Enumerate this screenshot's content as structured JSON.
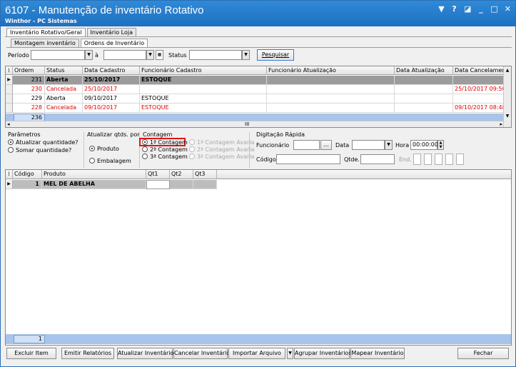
{
  "window": {
    "title": "6107 - Manutenção de inventário Rotativo",
    "subtitle": "Winthor - PC Sistemas",
    "controls": [
      "▼",
      "?",
      "◪",
      "_",
      "□",
      "✕"
    ]
  },
  "tabs_top": [
    "Inventário Rotativo/Geral",
    "Inventário Loja"
  ],
  "tabs_sub": [
    "Montagem inventário",
    "Ordens de Inventário"
  ],
  "filters": {
    "periodo_label": "Período",
    "a_label": "à",
    "status_label": "Status",
    "periodo_from": "",
    "periodo_to": "",
    "status_value": "",
    "search_button": "Pesquisar"
  },
  "orders_table": {
    "columns": [
      "Ordem",
      "Status",
      "Data Cadastro",
      "Funcionário Cadastro",
      "Funcionário Atualização",
      "Data Atualização",
      "Data Cancelamento"
    ],
    "rows": [
      {
        "ordem": "231",
        "status": "Aberta",
        "data_cadastro": "25/10/2017",
        "func_cadastro": "ESTOQUE",
        "func_atualizacao": "",
        "data_atualizacao": "",
        "data_cancelamento": ""
      },
      {
        "ordem": "230",
        "status": "Cancelada",
        "data_cadastro": "25/10/2017",
        "func_cadastro": "",
        "func_atualizacao": "",
        "data_atualizacao": "",
        "data_cancelamento": "25/10/2017 09:50:5"
      },
      {
        "ordem": "229",
        "status": "Aberta",
        "data_cadastro": "09/10/2017",
        "func_cadastro": "ESTOQUE",
        "func_atualizacao": "",
        "data_atualizacao": "",
        "data_cancelamento": ""
      },
      {
        "ordem": "228",
        "status": "Cancelada",
        "data_cadastro": "09/10/2017",
        "func_cadastro": "ESTOQUE",
        "func_atualizacao": "",
        "data_atualizacao": "",
        "data_cancelamento": "09/10/2017 08:48:4"
      }
    ],
    "footer_count": "236",
    "scroll_mid": "III"
  },
  "params": {
    "title": "Parâmetros",
    "atualizar_label": "Atualizar quantidade?",
    "somar_label": "Somar quantidade?",
    "atualizar_qtds_title": "Atualizar qtds. por",
    "produto_label": "Produto",
    "embalagem_label": "Embalagem",
    "contagem_title": "Contagem",
    "contagem_1": "1ª Contagem",
    "contagem_2": "2ª Contagem",
    "contagem_3": "3ª Contagem",
    "avaria_1": "1ª Contagem Avaria",
    "avaria_2": "2ª Contagem Avaria",
    "avaria_3": "3ª Contagem Avaria",
    "digitacao_title": "Digitação Rápida",
    "funcionario_label": "Funcionário",
    "data_label": "Data",
    "hora_label": "Hora",
    "hora_value": "00:00:00",
    "codigo_label": "Código",
    "qtde_label": "Qtde.",
    "end_label": "End.",
    "ellipsis": "..."
  },
  "products_table": {
    "columns": [
      "Código",
      "Produto",
      "Qt1",
      "Qt2",
      "Qt3"
    ],
    "rows": [
      {
        "codigo": "1",
        "produto": "MEL DE ABELHA",
        "qt1": "",
        "qt2": "",
        "qt3": ""
      }
    ],
    "footer_count": "1"
  },
  "actions": {
    "excluir": "Excluir Item",
    "emitir": "Emitir Relatórios",
    "atualizar": "Atualizar Inventário",
    "cancelar": "Cancelar Inventário",
    "importar": "Importar Arquivo",
    "agrupar": "Agrupar Inventários",
    "mapear": "Mapear Inventário",
    "fechar": "Fechar"
  },
  "colors": {
    "title_bar": "#1f6fc0",
    "cancel_red": "#e00000",
    "selected_row": "#9c9c9c",
    "footer_blue": "#a8c4ea",
    "highlight_box": "#e01515"
  }
}
